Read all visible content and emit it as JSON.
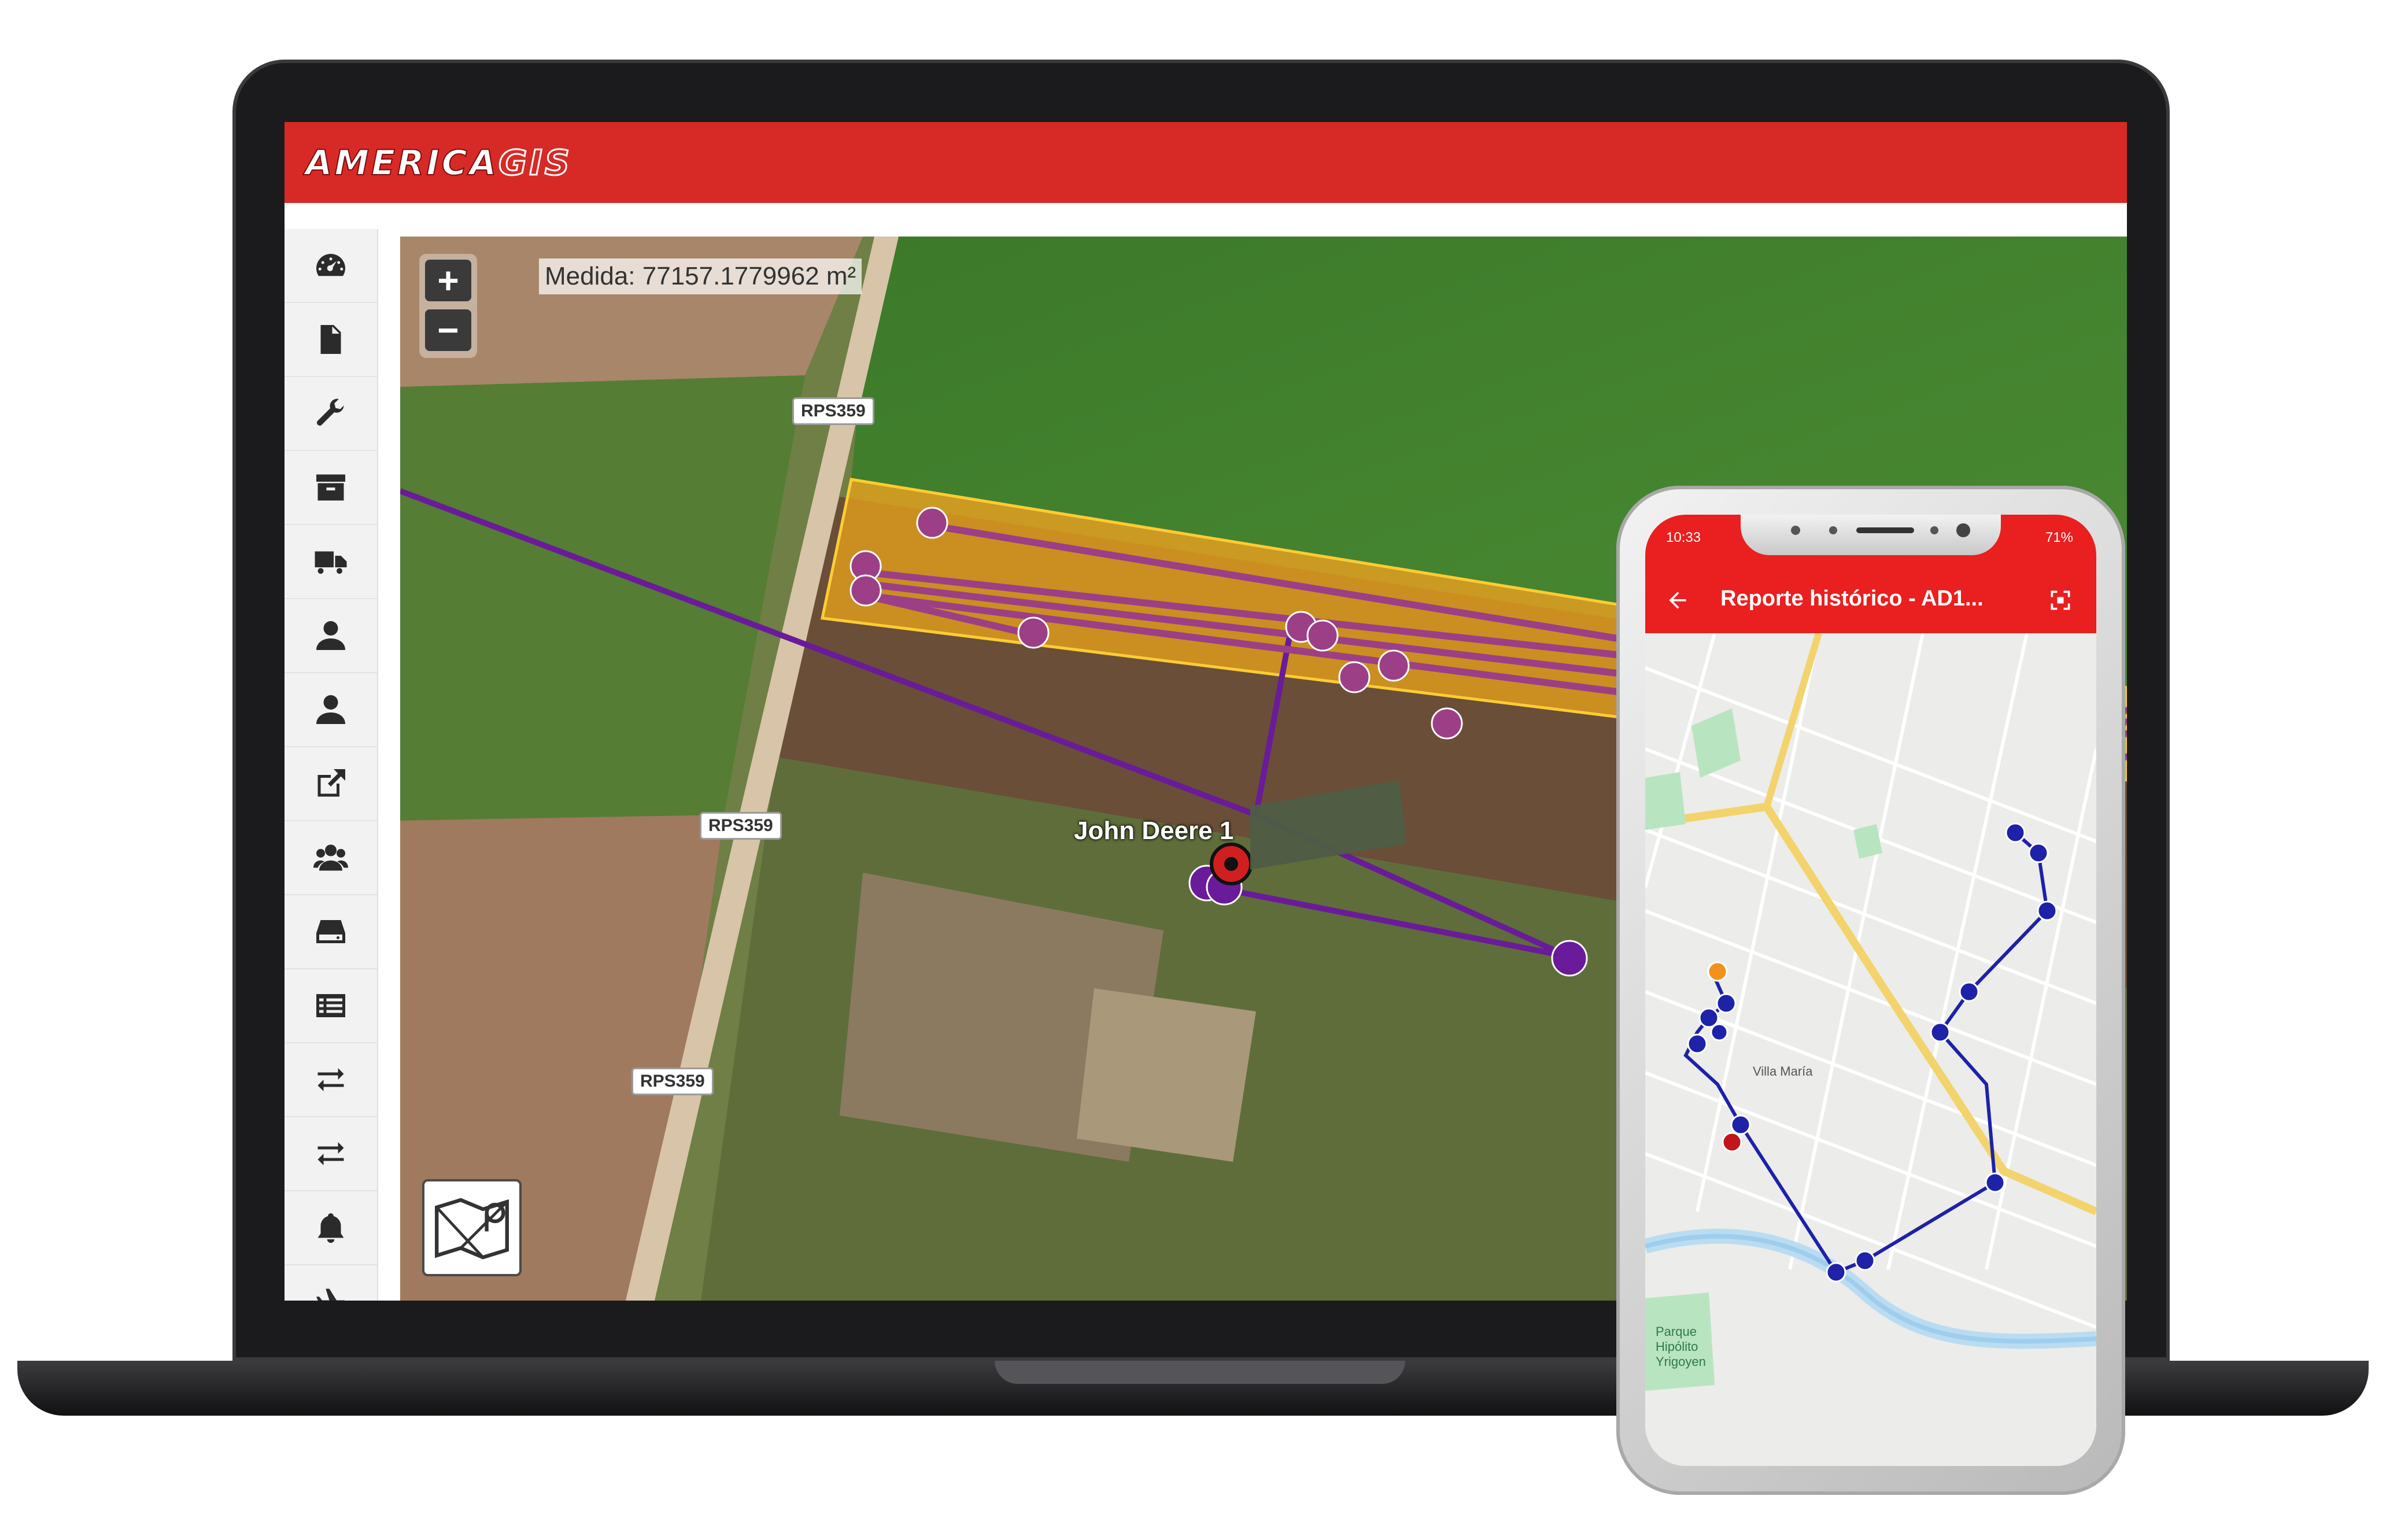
{
  "app": {
    "logo_part1": "AMERICA",
    "logo_part2": "GIS"
  },
  "sidebar": {
    "items": [
      {
        "icon": "dashboard-icon"
      },
      {
        "icon": "document-icon"
      },
      {
        "icon": "wrench-icon"
      },
      {
        "icon": "archive-icon"
      },
      {
        "icon": "truck-icon"
      },
      {
        "icon": "user-icon"
      },
      {
        "icon": "user-icon"
      },
      {
        "icon": "external-link-icon"
      },
      {
        "icon": "users-icon"
      },
      {
        "icon": "hard-drive-icon"
      },
      {
        "icon": "list-icon"
      },
      {
        "icon": "exchange-icon"
      },
      {
        "icon": "exchange-icon"
      },
      {
        "icon": "bell-icon"
      },
      {
        "icon": "plane-icon"
      }
    ]
  },
  "map": {
    "zoom_in": "+",
    "zoom_out": "−",
    "measure_text": "Medida: 77157.1779962 m²",
    "road_labels": [
      "RPS359",
      "RPS359",
      "RPS359"
    ],
    "device_label": "John Deere 1",
    "colors": {
      "field_polygon": "#e6a21a",
      "track_purple": "#6a1b9a",
      "track_magenta": "#9c3f86",
      "marker_red": "#d11f1f"
    }
  },
  "phone": {
    "status_time": "10:33",
    "status_battery": "71%",
    "back_icon": "arrow-left-icon",
    "title": "Reporte histórico - AD1...",
    "action_icon": "fullscreen-icon",
    "map_labels": {
      "neighborhood": "Villa María",
      "park": "Parque Hipólito Yrigoyen"
    },
    "colors": {
      "toolbar": "#ea1f1f",
      "route": "#1d22a8",
      "main_road": "#f3d36b"
    }
  }
}
